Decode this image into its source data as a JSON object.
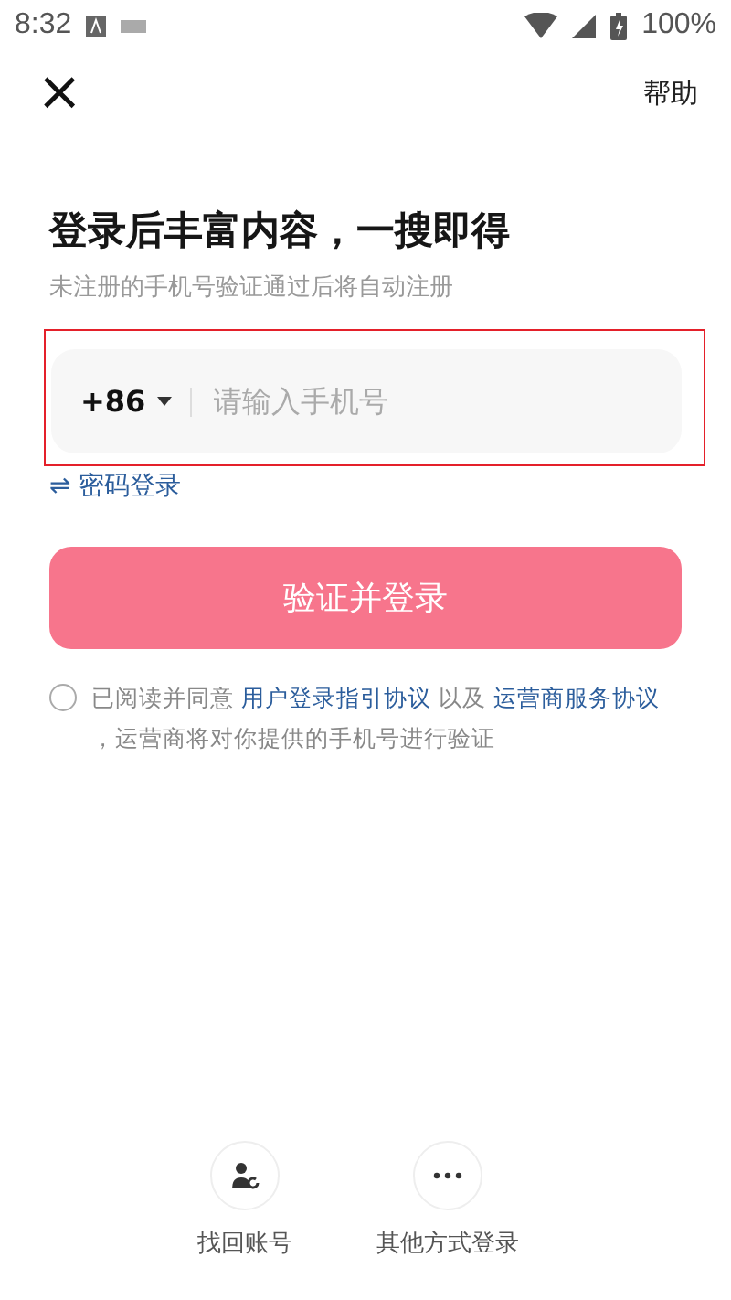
{
  "status_bar": {
    "time": "8:32",
    "battery": "100%"
  },
  "header": {
    "close": "×",
    "help": "帮助"
  },
  "title": "登录后丰富内容，一搜即得",
  "subtitle": "未注册的手机号验证通过后将自动注册",
  "phone_field": {
    "country_code": "+86",
    "placeholder": "请输入手机号",
    "highlighted": true
  },
  "switch_link": {
    "icon": "⇌",
    "label": "密码登录"
  },
  "submit_button": "验证并登录",
  "agreement": {
    "checked": false,
    "parts": [
      {
        "kind": "text",
        "text": "已阅读并同意 "
      },
      {
        "kind": "link",
        "text": "用户登录指引协议"
      },
      {
        "kind": "text",
        "text": " 以及 "
      },
      {
        "kind": "link",
        "text": "运营商服务协议"
      },
      {
        "kind": "text",
        "text": " ，运营商将对你提供的手机号进行验证"
      }
    ]
  },
  "bottom_options": [
    {
      "kind": "recover",
      "label": "找回账号"
    },
    {
      "kind": "more",
      "label": "其他方式登录"
    }
  ]
}
